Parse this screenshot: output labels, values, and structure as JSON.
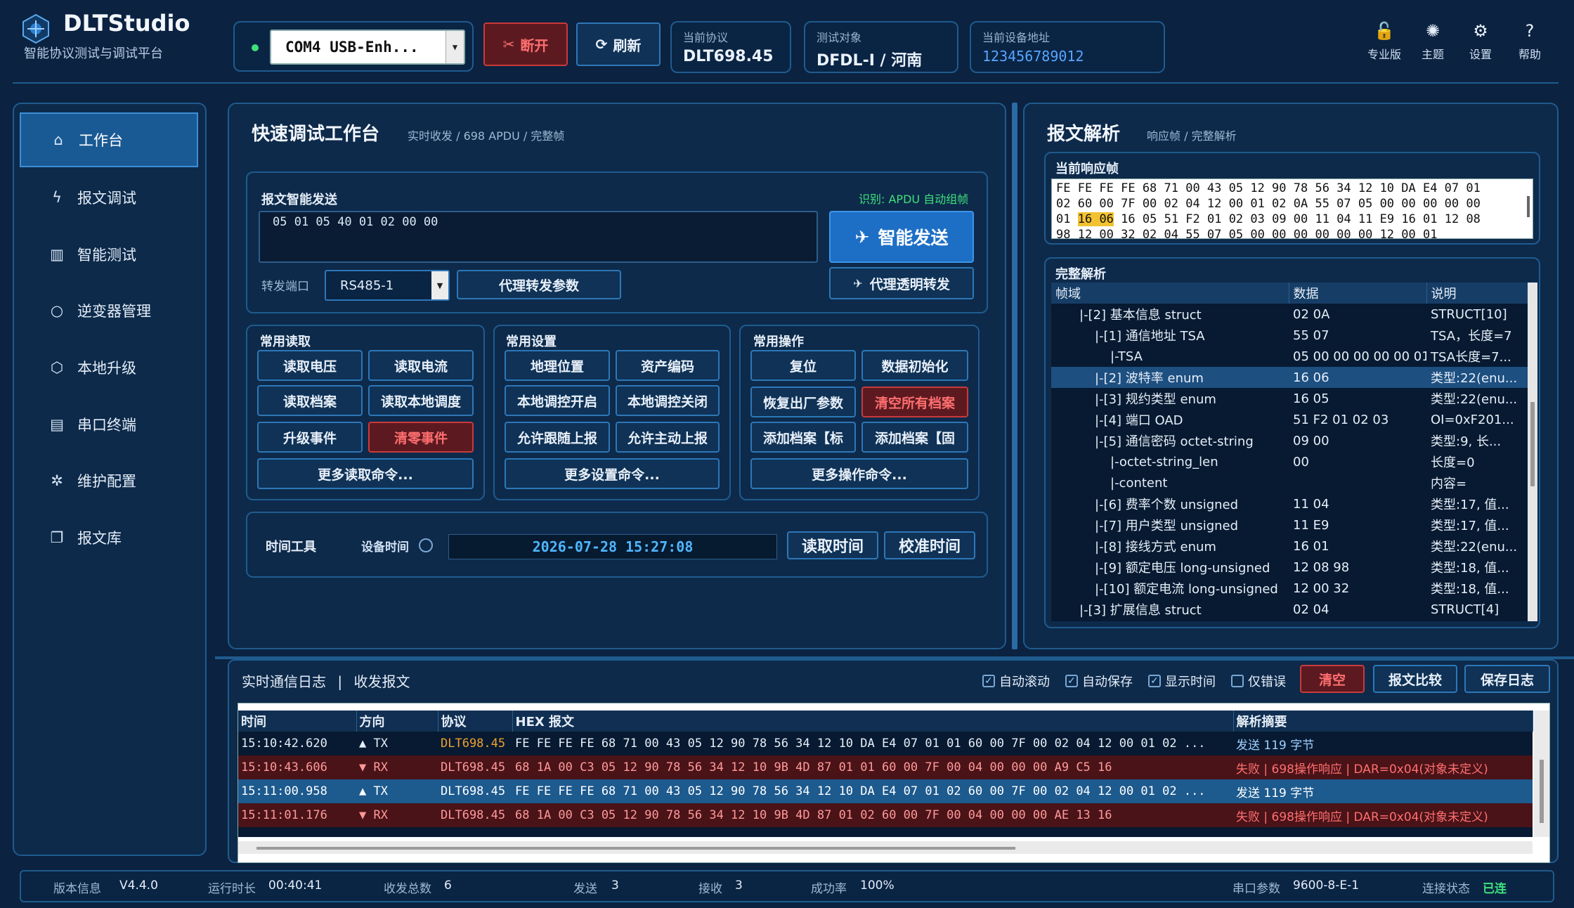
{
  "app": {
    "title": "DLTStudio",
    "subtitle": "智能协议测试与调试平台"
  },
  "header": {
    "port_select": "COM4 USB-Enh...",
    "disconnect_label": "断开",
    "refresh_label": "刷新",
    "protocol_title": "当前协议",
    "protocol_value": "DLT698.45",
    "target_title": "测试对象",
    "target_value": "DFDL-I / 河南",
    "address_title": "当前设备地址",
    "address_value": "123456789012",
    "tools": [
      {
        "label": "专业版",
        "icon": "lock-icon"
      },
      {
        "label": "主题",
        "icon": "theme-icon"
      },
      {
        "label": "设置",
        "icon": "gear-icon"
      },
      {
        "label": "帮助",
        "icon": "help-icon"
      }
    ]
  },
  "sidebar": {
    "items": [
      {
        "label": "工作台",
        "icon": "home-icon"
      },
      {
        "label": "报文调试",
        "icon": "bolt-icon"
      },
      {
        "label": "智能测试",
        "icon": "chart-icon"
      },
      {
        "label": "逆变器管理",
        "icon": "circle-icon"
      },
      {
        "label": "本地升级",
        "icon": "box-icon"
      },
      {
        "label": "串口终端",
        "icon": "terminal-icon"
      },
      {
        "label": "维护配置",
        "icon": "tools-icon"
      },
      {
        "label": "报文库",
        "icon": "library-icon"
      }
    ]
  },
  "workbench": {
    "title": "快速调试工作台",
    "subtitle": "实时收发 / 698 APDU / 完整帧",
    "send": {
      "title": "报文智能发送",
      "hint": "识别: APDU 自动组帧",
      "apdu_value": "05 01 05 40 01 02 00 00",
      "smart_send_label": "智能发送",
      "port_label": "转发端口",
      "port_value": "RS485-1",
      "proxy_params_label": "代理转发参数",
      "proxy_transparent_label": "代理透明转发"
    },
    "read_group": {
      "title": "常用读取",
      "buttons": [
        "读取电压",
        "读取电流",
        "读取档案",
        "读取本地调度",
        "升级事件",
        "清零事件"
      ],
      "more_label": "更多读取命令..."
    },
    "set_group": {
      "title": "常用设置",
      "buttons": [
        "地理位置",
        "资产编码",
        "本地调控开启",
        "本地调控关闭",
        "允许跟随上报",
        "允许主动上报"
      ],
      "more_label": "更多设置命令..."
    },
    "op_group": {
      "title": "常用操作",
      "buttons": [
        "复位",
        "数据初始化",
        "恢复出厂参数",
        "清空所有档案",
        "添加档案【标",
        "添加档案【固"
      ],
      "more_label": "更多操作命令..."
    },
    "time_tool": {
      "title": "时间工具",
      "device_time_label": "设备时间",
      "time_value": "2026-07-28 15:27:08",
      "read_label": "读取时间",
      "calibrate_label": "校准时间"
    }
  },
  "parse": {
    "title": "报文解析",
    "subtitle": "响应帧 / 完整解析",
    "frame_title": "当前响应帧",
    "frame_lines": [
      "FE FE FE FE 68 71 00 43 05 12 90 78 56 34 12 10 DA E4 07 01",
      "02 60 00 7F 00 02 04 12 00 01 02 0A 55 07 05 00 00 00 00 00",
      "16 05 51 F2 01 02 03 09 00 11 04 11 E9 16 01 12 08",
      "98 12 00 32 02 04 55 07 05 00 00 00 00 00 00 12 00 01"
    ],
    "frame_line3_prefix": "01",
    "frame_highlight": "16 06",
    "full_title": "完整解析",
    "columns": [
      "帧域",
      "数据",
      "说明"
    ],
    "rows": [
      {
        "field": "|-[2] 基本信息 struct",
        "data": "02 0A",
        "desc": "STRUCT[10]",
        "indent": 1
      },
      {
        "field": "|-[1] 通信地址 TSA",
        "data": "55 07",
        "desc": "TSA，长度=7",
        "indent": 2
      },
      {
        "field": "|-TSA",
        "data": "05 00 00 00 00 00 01",
        "desc": "TSA长度=7...",
        "indent": 3
      },
      {
        "field": "|-[2] 波特率 enum",
        "data": "16 06",
        "desc": "类型:22(enu...",
        "indent": 2,
        "selected": true
      },
      {
        "field": "|-[3] 规约类型 enum",
        "data": "16 05",
        "desc": "类型:22(enu...",
        "indent": 2
      },
      {
        "field": "|-[4] 端口 OAD",
        "data": "51 F2 01 02 03",
        "desc": "OI=0xF201...",
        "indent": 2
      },
      {
        "field": "|-[5] 通信密码 octet-string",
        "data": "09 00",
        "desc": "类型:9, 长...",
        "indent": 2
      },
      {
        "field": "|-octet-string_len",
        "data": "00",
        "desc": "长度=0",
        "indent": 3
      },
      {
        "field": "|-content",
        "data": "",
        "desc": "内容=",
        "indent": 3
      },
      {
        "field": "|-[6] 费率个数 unsigned",
        "data": "11 04",
        "desc": "类型:17, 值...",
        "indent": 2
      },
      {
        "field": "|-[7] 用户类型 unsigned",
        "data": "11 E9",
        "desc": "类型:17, 值...",
        "indent": 2
      },
      {
        "field": "|-[8] 接线方式 enum",
        "data": "16 01",
        "desc": "类型:22(enu...",
        "indent": 2
      },
      {
        "field": "|-[9] 额定电压 long-unsigned",
        "data": "12 08 98",
        "desc": "类型:18, 值...",
        "indent": 2
      },
      {
        "field": "|-[10] 额定电流 long-unsigned",
        "data": "12 00 32",
        "desc": "类型:18, 值...",
        "indent": 2
      },
      {
        "field": "|-[3] 扩展信息 struct",
        "data": "02 04",
        "desc": "STRUCT[4]",
        "indent": 1
      }
    ]
  },
  "log": {
    "title": "实时通信日志",
    "separator": "|",
    "subtitle": "收发报文",
    "auto_scroll": "自动滚动",
    "auto_save": "自动保存",
    "show_time": "显示时间",
    "errors_only": "仅错误",
    "clear_label": "清空",
    "compare_label": "报文比较",
    "save_label": "保存日志",
    "columns": [
      "时间",
      "方向",
      "协议",
      "HEX 报文",
      "解析摘要"
    ],
    "rows": [
      {
        "time": "15:10:42.620",
        "dir": "▲ TX",
        "proto": "DLT698.45",
        "hex": "FE FE FE FE 68 71 00 43 05 12 90 78 56 34 12 10 DA E4 07 01 01 60 00 7F 00 02 04 12 00 01 02 ...",
        "summary": "发送 119 字节",
        "type": "tx"
      },
      {
        "time": "15:10:43.606",
        "dir": "▼ RX",
        "proto": "DLT698.45",
        "hex": "68 1A 00 C3 05 12 90 78 56 34 12 10 9B 4D 87 01 01 60 00 7F 00 04 00 00 00 A9 C5 16",
        "summary": "失败 | 698操作响应 | DAR=0x04(对象未定义)",
        "type": "rx"
      },
      {
        "time": "15:11:00.958",
        "dir": "▲ TX",
        "proto": "DLT698.45",
        "hex": "FE FE FE FE 68 71 00 43 05 12 90 78 56 34 12 10 DA E4 07 01 02 60 00 7F 00 02 04 12 00 01 02 ...",
        "summary": "发送 119 字节",
        "type": "tx-sel"
      },
      {
        "time": "15:11:01.176",
        "dir": "▼ RX",
        "proto": "DLT698.45",
        "hex": "68 1A 00 C3 05 12 90 78 56 34 12 10 9B 4D 87 01 02 60 00 7F 00 04 00 00 00 AE 13 16",
        "summary": "失败 | 698操作响应 | DAR=0x04(对象未定义)",
        "type": "rx"
      }
    ]
  },
  "status": {
    "version_label": "版本信息",
    "version_value": "V4.4.0",
    "runtime_label": "运行时长",
    "runtime_value": "00:40:41",
    "total_label": "收发总数",
    "total_value": "6",
    "send_label": "发送",
    "send_value": "3",
    "recv_label": "接收",
    "recv_value": "3",
    "success_label": "成功率",
    "success_value": "100%",
    "serial_label": "串口参数",
    "serial_value": "9600-8-E-1",
    "conn_label": "连接状态",
    "conn_value": "已连"
  },
  "colors": {
    "accent": "#1d6fc6",
    "danger": "#ff6f6f",
    "success": "#3ee07a",
    "highlight": "#f2c230",
    "proto_orange": "#f0a030"
  }
}
